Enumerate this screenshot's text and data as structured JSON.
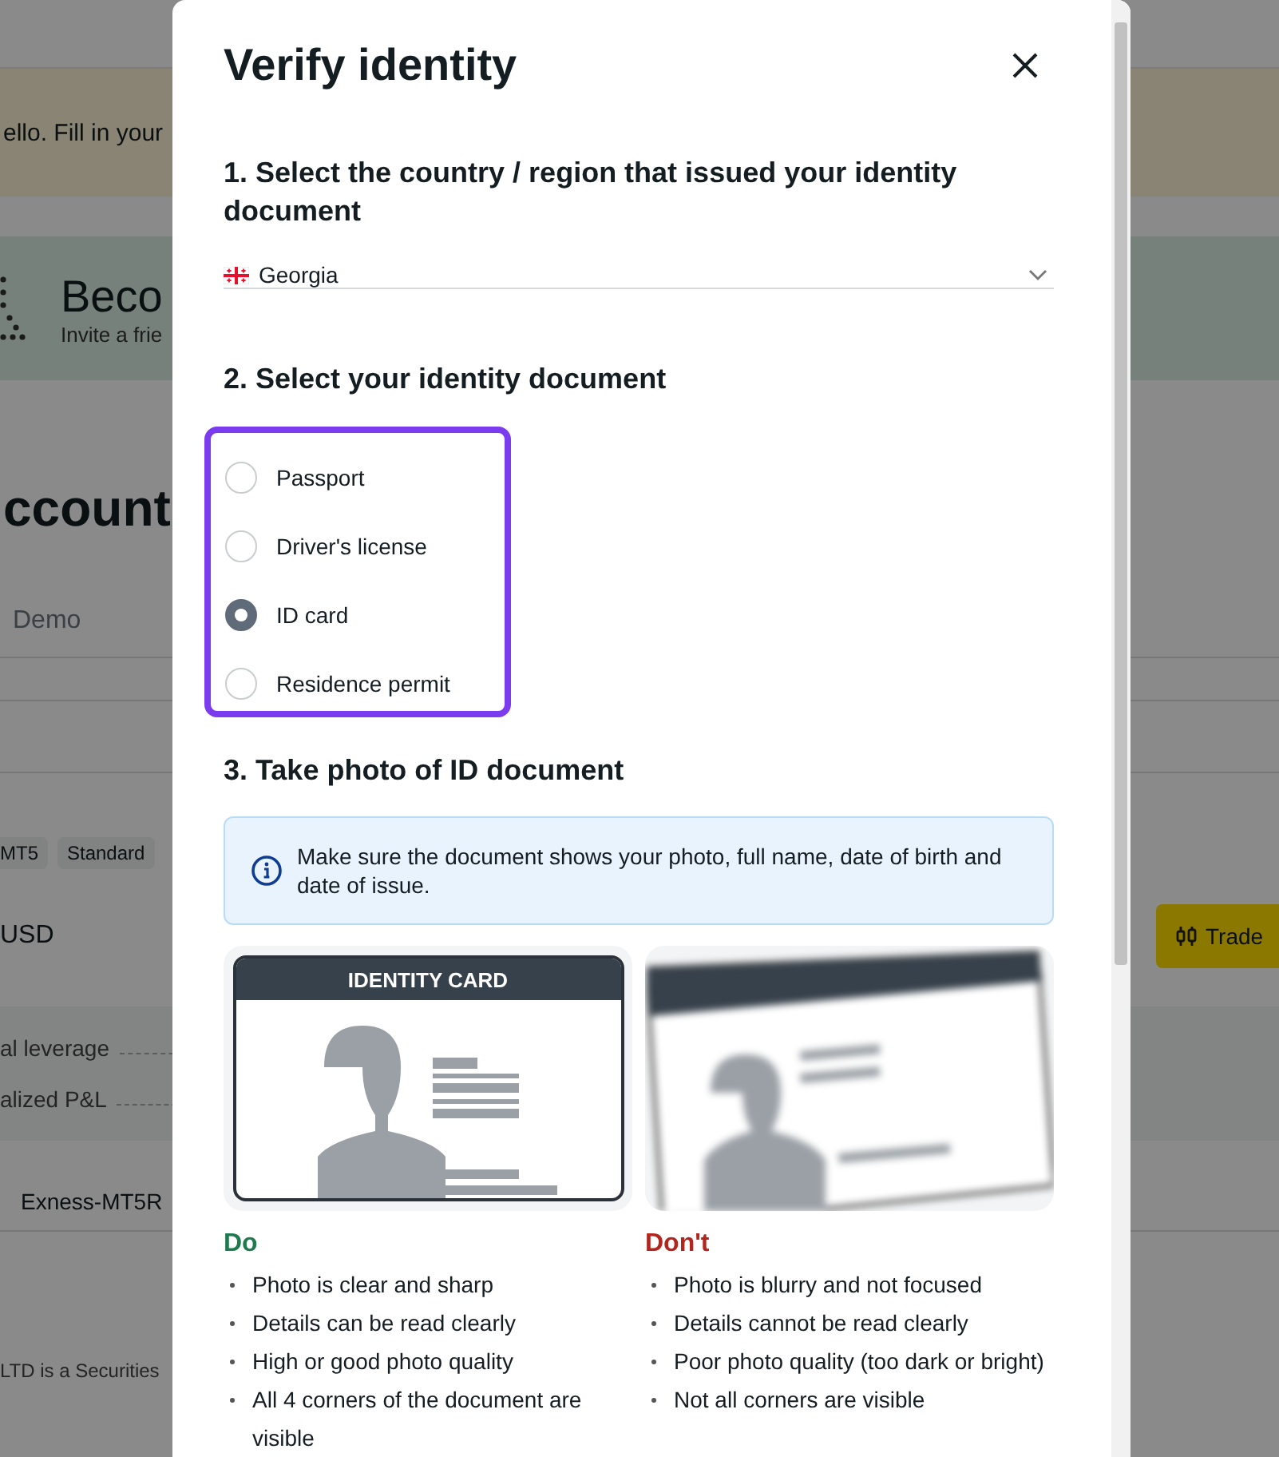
{
  "background": {
    "banner": "ello. Fill in your",
    "promo": {
      "title": "Beco",
      "subtitle": "Invite a frie"
    },
    "heading": "ccount",
    "tabs": [
      {
        "label": "Demo",
        "selected": false
      }
    ],
    "chips": [
      "MT5",
      "Standard"
    ],
    "currency": "USD",
    "trade_button": "Trade",
    "stats": [
      "al leverage",
      "alized P&L"
    ],
    "server": "Exness-MT5R",
    "footer": "LTD is a Securities"
  },
  "modal": {
    "title": "Verify identity",
    "country_section": {
      "heading": "1. Select the country / region that issued your identity document",
      "value": "Georgia"
    },
    "document_section": {
      "heading": "2. Select your identity document",
      "highlighted": true,
      "options": [
        {
          "label": "Passport",
          "selected": false
        },
        {
          "label": "Driver's license",
          "selected": false
        },
        {
          "label": "ID card",
          "selected": true
        },
        {
          "label": "Residence permit",
          "selected": false
        }
      ]
    },
    "photo_section": {
      "heading": "3. Take photo of ID document",
      "info": "Make sure the document shows your photo, full name, date of birth and date of issue.",
      "guides": [
        {
          "kind": "good",
          "card_title": "IDENTITY CARD",
          "heading": "Do",
          "tips": [
            "Photo is clear and sharp",
            "Details can be read clearly",
            "High or good photo quality",
            "All 4 corners of the document are visible"
          ]
        },
        {
          "kind": "bad",
          "heading": "Don't",
          "tips": [
            "Photo is blurry and not focused",
            "Details cannot be read clearly",
            "Poor photo quality (too dark or bright)",
            "Not all corners are visible"
          ]
        }
      ]
    }
  }
}
